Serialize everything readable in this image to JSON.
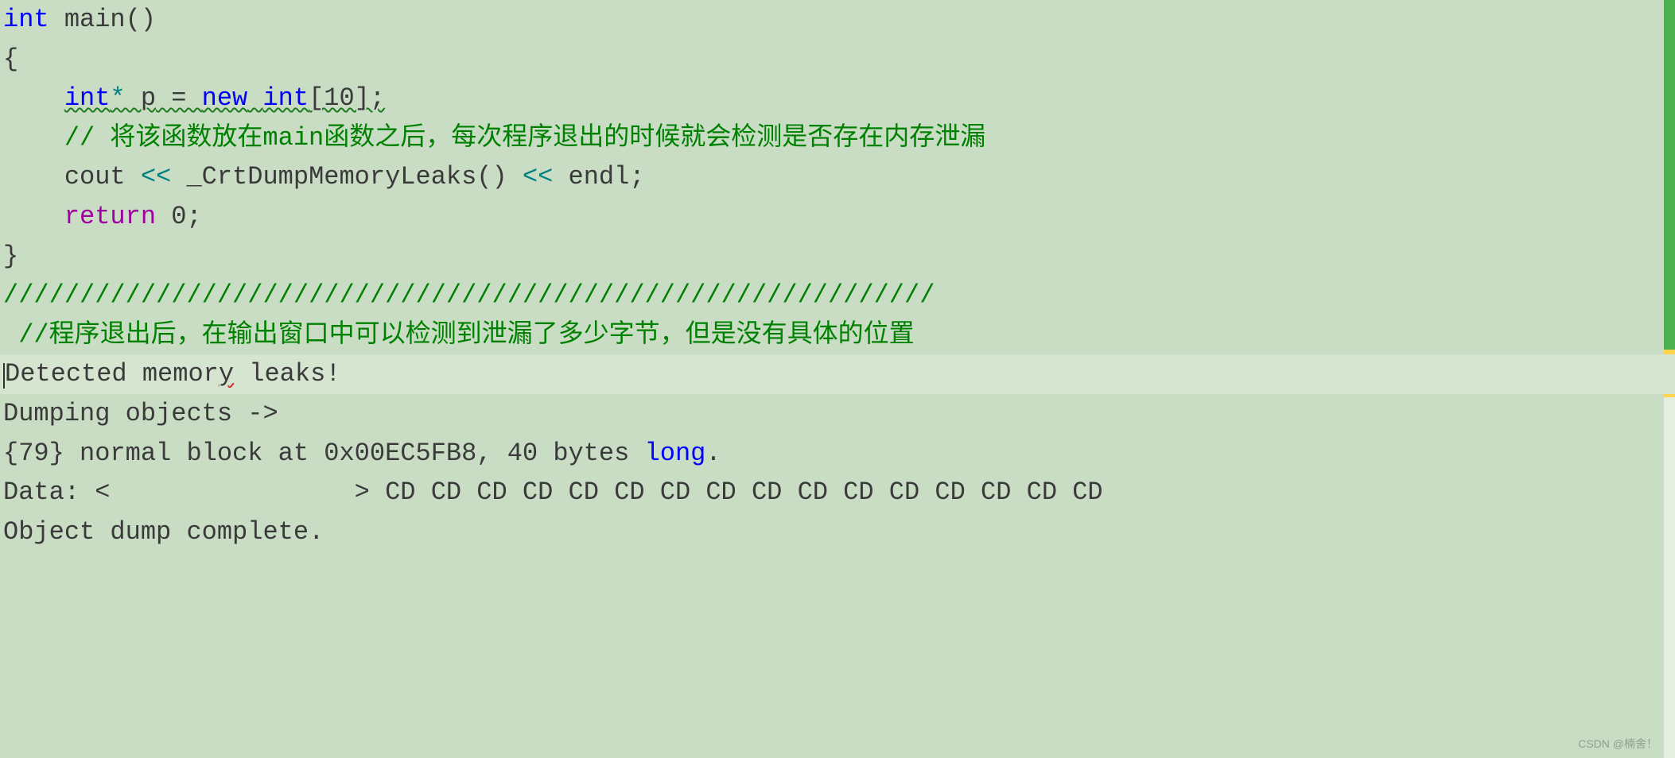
{
  "code": {
    "line1": {
      "int": "int",
      "main": " main",
      "paren": "()"
    },
    "line2": "{",
    "line3": {
      "indent": "    ",
      "int": "int",
      "star": "* ",
      "p": "p",
      "equals": " = ",
      "new": "new",
      "space": " ",
      "int2": "int",
      "bracket": "[10];"
    },
    "line4": {
      "indent": "    ",
      "comment": "// 将该函数放在main函数之后，每次程序退出的时候就会检测是否存在内存泄漏"
    },
    "line5": {
      "indent": "    ",
      "cout": "cout ",
      "op1": "<<",
      "func": " _CrtDumpMemoryLeaks",
      "paren": "() ",
      "op2": "<<",
      "endl": " endl",
      "semi": ";"
    },
    "line6": {
      "indent": "    ",
      "return": "return",
      "zero": " 0",
      "semi": ";"
    },
    "line7": "}",
    "line8": "/////////////////////////////////////////////////////////////",
    "line9": " //程序退出后，在输出窗口中可以检测到泄漏了多少字节，但是没有具体的位置",
    "line10": {
      "text1": "Detected memor",
      "y": "y",
      "text2": " leaks!"
    },
    "line11": "Dumping objects ->",
    "line12": {
      "prefix": "{79} normal block at 0x00EC5FB8, 40 bytes ",
      "long": "long",
      "dot": "."
    },
    "line13": "Data: <                > CD CD CD CD CD CD CD CD CD CD CD CD CD CD CD CD ",
    "line14": "Object dump complete."
  },
  "watermark": "CSDN @楠舍！",
  "colors": {
    "background": "#c8ddc4",
    "keyword_blue": "#0000ff",
    "comment_green": "#008000",
    "return_purple": "#a000a0",
    "operator_teal": "#008080",
    "text_dark": "#3a3a3a"
  }
}
